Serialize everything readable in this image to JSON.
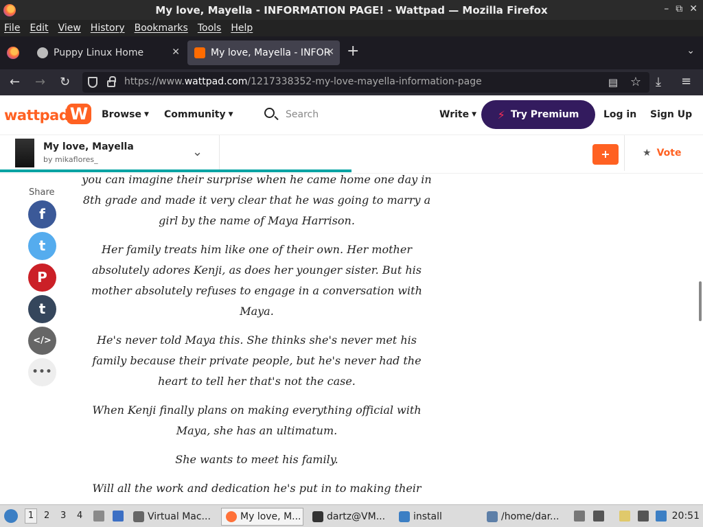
{
  "window": {
    "title": "My love, Mayella - INFORMATION PAGE! - Wattpad — Mozilla Firefox"
  },
  "menubar": [
    "File",
    "Edit",
    "View",
    "History",
    "Bookmarks",
    "Tools",
    "Help"
  ],
  "tabs": [
    {
      "label": "Puppy Linux Home"
    },
    {
      "label": "My love, Mayella - INFOR"
    }
  ],
  "navbar": {
    "url_prefix": "https://www.",
    "url_domain": "wattpad.com",
    "url_path": "/1217338352-my-love-mayella-information-page"
  },
  "wattpad": {
    "logo": "wattpad",
    "nav": {
      "browse": "Browse",
      "community": "Community"
    },
    "search_placeholder": "Search",
    "write": "Write",
    "premium": "Try Premium",
    "login": "Log in",
    "signup": "Sign Up"
  },
  "story": {
    "title": "My love, Mayella",
    "author": "by mikaflores_",
    "vote": "Vote",
    "add": "+",
    "progress_fraction": 0.5
  },
  "share": {
    "label": "Share"
  },
  "paragraphs": [
    "you can imagine their surprise when he came home one day in 8th grade and made it very clear that he was going to marry a girl by the name of Maya Harrison.",
    "Her family treats him like one of their own. Her mother absolutely adores Kenji, as does her younger sister. But his mother absolutely refuses to engage in a conversation with Maya.",
    "He's never told Maya this. She thinks she's never met his family because their private people, but he's never had the heart to tell her that's not the case.",
    "When Kenji finally plans on making everything official with Maya, she has an ultimatum.",
    "She wants to meet his family.",
    "Will all the work and dedication he's put in to making their relationship official go to waste when she meets the rejection of his family?"
  ],
  "taskbar": {
    "workspaces": [
      "1",
      "2",
      "3",
      "4"
    ],
    "items": [
      "Virtual Mac...",
      "My love, M...",
      "dartz@VM...",
      "install",
      "/home/dar..."
    ],
    "clock": "20:51"
  }
}
